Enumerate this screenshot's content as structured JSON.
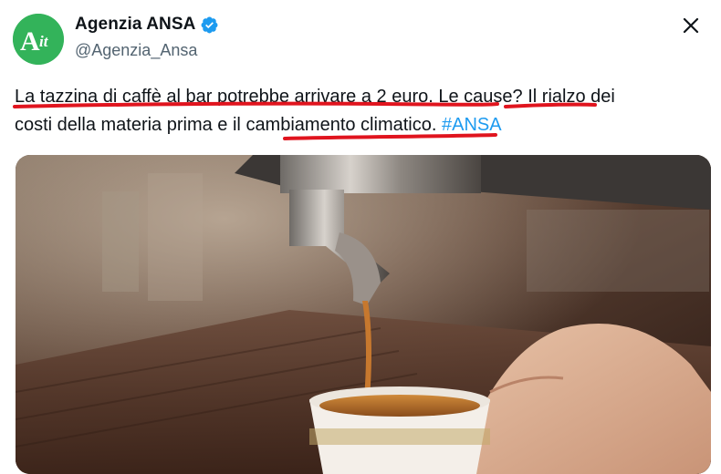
{
  "account": {
    "avatar_text": "Ait",
    "display_name": "Agenzia ANSA",
    "handle": "@Agenzia_Ansa",
    "verified": true,
    "avatar_color": "#33b35a",
    "verified_color": "#1d9bf0"
  },
  "tweet": {
    "segments": [
      "La tazzina di caffè al bar potrebbe arrivare a 2 euro",
      ". ",
      "Le cause",
      "? Il rialzo dei",
      "costi della materia prima e il ",
      "cambiamento climatico",
      ". ",
      "#ANSA"
    ],
    "hashtag_color": "#1d9bf0",
    "underline_color": "#e0141e"
  },
  "media": {
    "description_icon": "espresso-photo"
  },
  "icons": {
    "close": "close-icon",
    "verified": "verified-badge-icon"
  }
}
